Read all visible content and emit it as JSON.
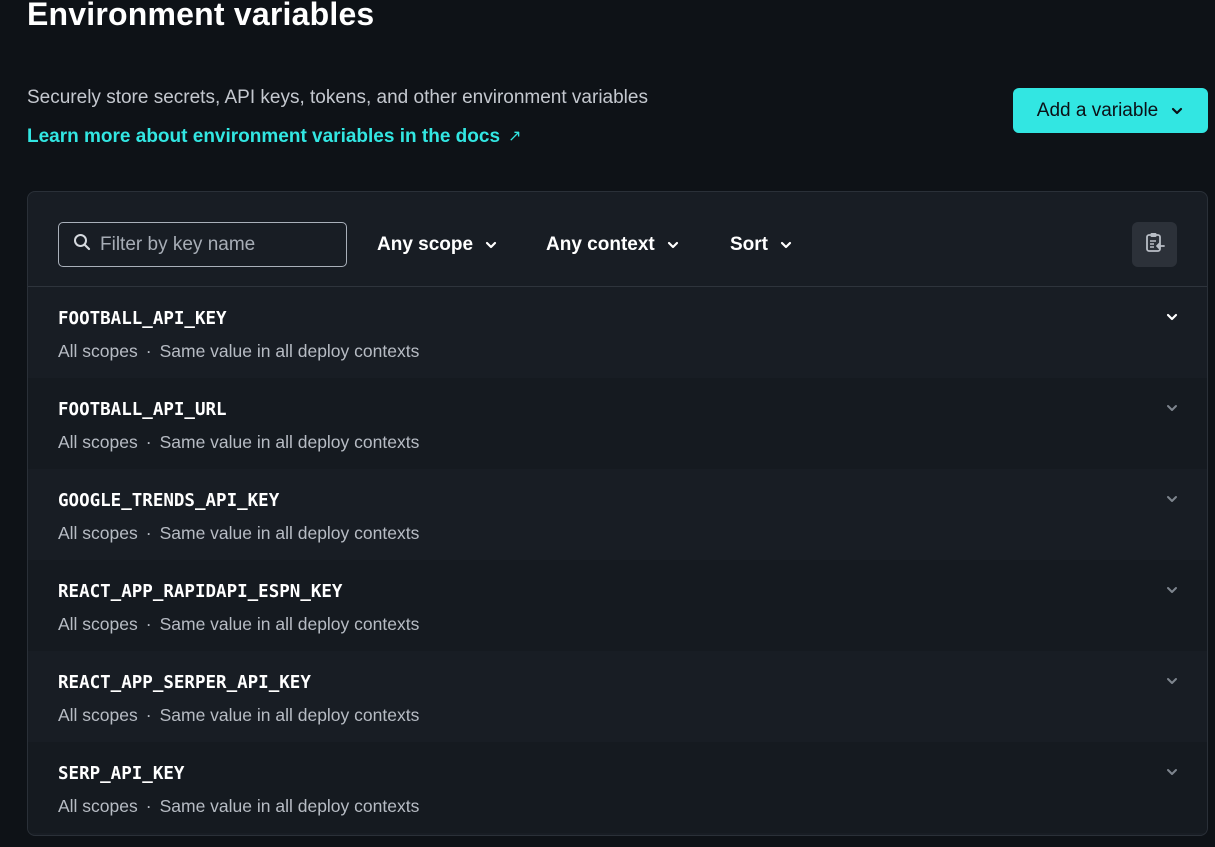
{
  "header": {
    "title": "Environment variables",
    "subtitle": "Securely store secrets, API keys, tokens, and other environment variables",
    "docs_link": "Learn more about environment variables in the docs",
    "docs_link_icon": "↗",
    "add_button": "Add a variable"
  },
  "toolbar": {
    "search_placeholder": "Filter by key name",
    "scope_filter": "Any scope",
    "context_filter": "Any context",
    "sort": "Sort"
  },
  "variables": [
    {
      "key": "FOOTBALL_API_KEY",
      "scope": "All scopes",
      "context": "Same value in all deploy contexts"
    },
    {
      "key": "FOOTBALL_API_URL",
      "scope": "All scopes",
      "context": "Same value in all deploy contexts"
    },
    {
      "key": "GOOGLE_TRENDS_API_KEY",
      "scope": "All scopes",
      "context": "Same value in all deploy contexts"
    },
    {
      "key": "REACT_APP_RAPIDAPI_ESPN_KEY",
      "scope": "All scopes",
      "context": "Same value in all deploy contexts"
    },
    {
      "key": "REACT_APP_SERPER_API_KEY",
      "scope": "All scopes",
      "context": "Same value in all deploy contexts"
    },
    {
      "key": "SERP_API_KEY",
      "scope": "All scopes",
      "context": "Same value in all deploy contexts"
    }
  ],
  "separator": "·",
  "colors": {
    "accent": "#32e6e2",
    "background": "#0e1217",
    "panel": "#181d24"
  },
  "icons": {
    "search": "search-icon",
    "chevron": "chevron-down-icon",
    "export": "clipboard-export-icon",
    "external": "external-link-icon"
  }
}
